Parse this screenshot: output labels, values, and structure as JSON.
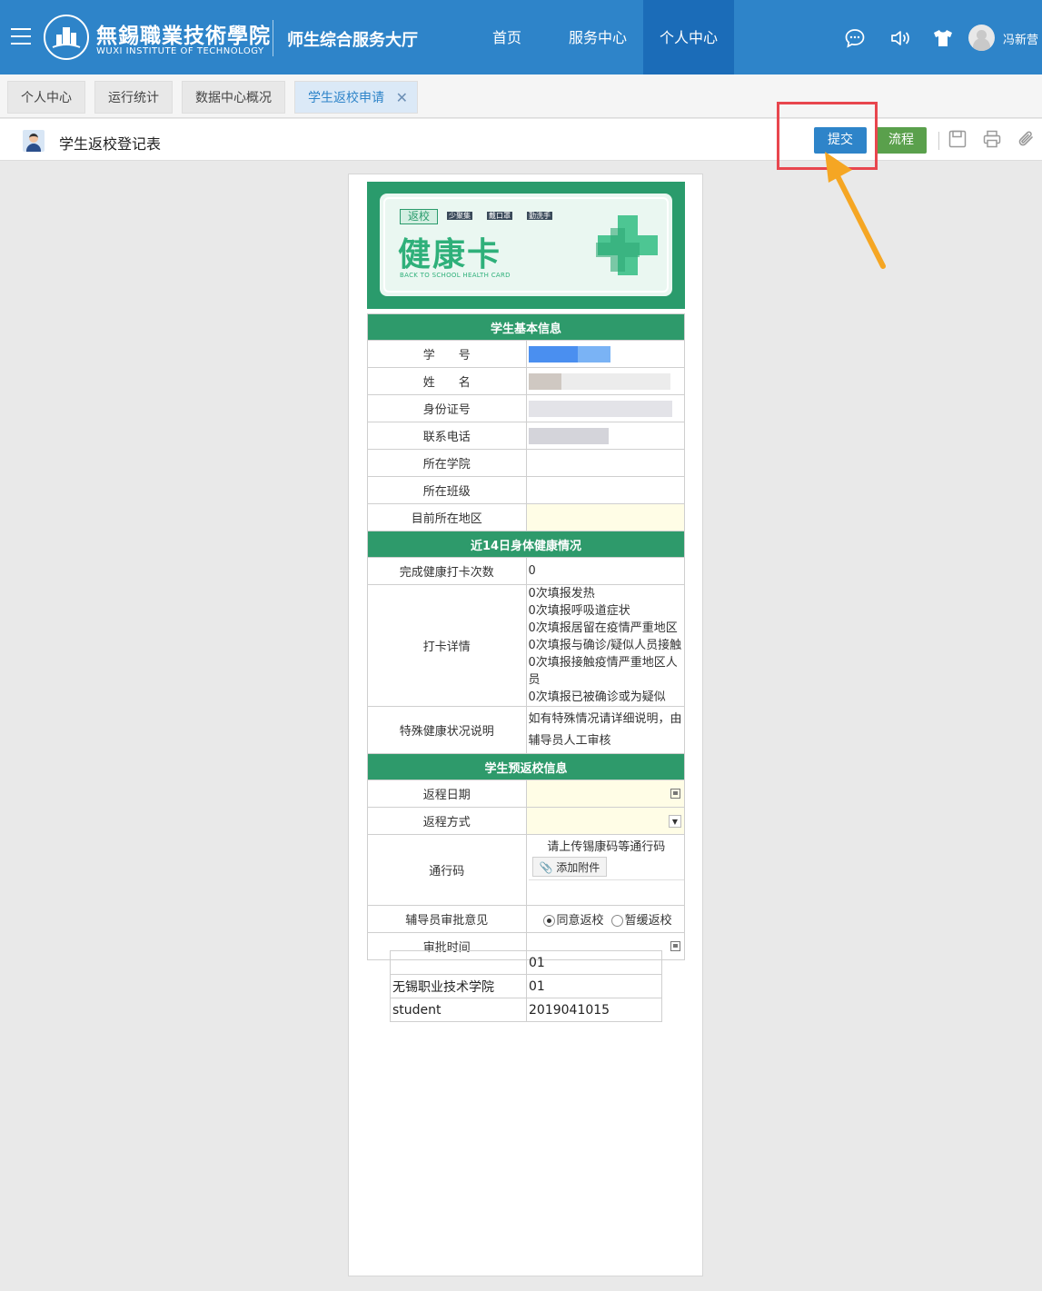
{
  "header": {
    "school_name_cn": "無錫職業技術學院",
    "school_name_en": "WUXI INSTITUTE OF TECHNOLOGY",
    "system_title": "师生综合服务大厅",
    "nav": [
      "首页",
      "服务中心",
      "个人中心"
    ],
    "active_nav": "个人中心",
    "user_name": "冯新营"
  },
  "tabs": [
    "个人中心",
    "运行统计",
    "数据中心概况",
    "学生返校申请"
  ],
  "active_tab": "学生返校申请",
  "form_toolbar": {
    "title": "学生返校登记表",
    "submit_label": "提交",
    "flow_label": "流程"
  },
  "banner": {
    "tag": "返校",
    "slogans": [
      "少聚集",
      "戴口罩",
      "勤洗手"
    ],
    "title": "健康卡",
    "subtitle": "BACK TO SCHOOL HEALTH CARD"
  },
  "form": {
    "section_basic": "学生基本信息",
    "labels_basic": [
      "学　　号",
      "姓　　名",
      "身份证号",
      "联系电话",
      "所在学院",
      "所在班级",
      "目前所在地区"
    ],
    "section_health": "近14日身体健康情况",
    "checkin_count_label": "完成健康打卡次数",
    "checkin_count_value": "0",
    "checkin_detail_label": "打卡详情",
    "checkin_details": [
      "0次填报发热",
      "0次填报呼吸道症状",
      "0次填报居留在疫情严重地区",
      "0次填报与确诊/疑似人员接触",
      "0次填报接触疫情严重地区人员",
      "0次填报已被确诊或为疑似"
    ],
    "special_label": "特殊健康状况说明",
    "special_placeholder": "如有特殊情况请详细说明，由辅导员人工审核",
    "section_return": "学生预返校信息",
    "return_date_label": "返程日期",
    "return_mode_label": "返程方式",
    "pass_code_label": "通行码",
    "pass_code_hint": "请上传锡康码等通行码",
    "attach_label": "添加附件",
    "counselor_label": "辅导员审批意见",
    "opinion_options": [
      "同意返校",
      "暂缓返校"
    ],
    "opinion_selected": "同意返校",
    "approve_time_label": "审批时间"
  },
  "meta_rows": [
    [
      "",
      "01"
    ],
    [
      "无锡职业技术学院",
      "01"
    ],
    [
      "student",
      "2019041015"
    ]
  ],
  "colors": {
    "header_blue": "#2e84c9",
    "section_green": "#2e9a6b",
    "flow_green": "#5aa04c",
    "highlight_red": "#e8464e",
    "arrow_orange": "#f5a623"
  }
}
